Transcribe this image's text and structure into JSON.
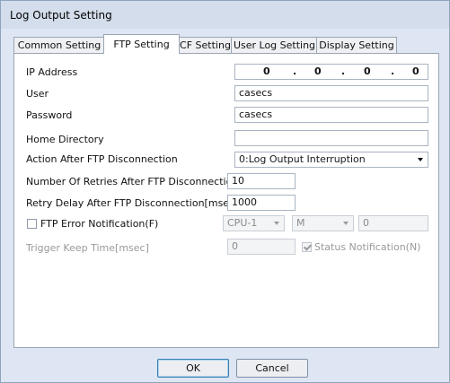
{
  "window": {
    "title": "Log Output Setting"
  },
  "tabs": [
    {
      "label": "Common Setting"
    },
    {
      "label": "FTP Setting"
    },
    {
      "label": "CF Setting"
    },
    {
      "label": "User Log Setting"
    },
    {
      "label": "Display Setting"
    }
  ],
  "active_tab": "FTP Setting",
  "form": {
    "ip": {
      "label": "IP Address",
      "octets": [
        "0",
        "0",
        "0",
        "0"
      ],
      "separator": "."
    },
    "user": {
      "label": "User",
      "value": "casecs"
    },
    "password": {
      "label": "Password",
      "value": "casecs"
    },
    "home_dir": {
      "label": "Home Directory",
      "value": ""
    },
    "action": {
      "label": "Action After FTP Disconnection",
      "value": "0:Log Output Interruption"
    },
    "retries": {
      "label": "Number Of Retries After FTP Disconnection",
      "value": "10"
    },
    "retry_delay": {
      "label": "Retry Delay After FTP Disconnection[msec]",
      "value": "1000"
    },
    "error_notification": {
      "label": "FTP Error Notification(F)",
      "checked": false,
      "cpu": "CPU-1",
      "device": "M",
      "number": "0"
    },
    "trigger_keep": {
      "label": "Trigger Keep Time[msec]",
      "value": "0"
    },
    "status_notification": {
      "label": "Status Notification(N)",
      "checked": true
    }
  },
  "buttons": {
    "ok": "OK",
    "cancel": "Cancel"
  }
}
